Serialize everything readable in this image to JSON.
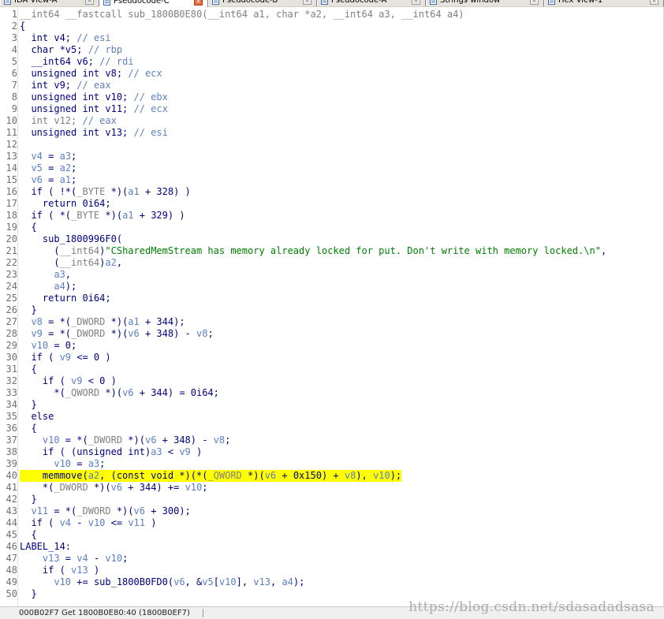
{
  "tabs": [
    {
      "label": "IDA View-A",
      "active": false
    },
    {
      "label": "Pseudocode-C",
      "active": true
    },
    {
      "label": "Pseudocode-B",
      "active": false
    },
    {
      "label": "Pseudocode-A",
      "active": false
    },
    {
      "label": "Strings window",
      "active": false
    },
    {
      "label": "Hex View-1",
      "active": false
    }
  ],
  "colors": {
    "keyword": "#000080",
    "variable": "#5b7fc4",
    "string": "#008000",
    "highlight": "#ffff00"
  },
  "code": {
    "lines": [
      {
        "n": "1",
        "tokens": [
          [
            "g",
            "__int64 __fastcall sub_1800B0E80(__int64 a1, char *a2, __int64 a3, __int64 a4)"
          ]
        ]
      },
      {
        "n": "2",
        "tokens": [
          [
            "k",
            "{"
          ]
        ]
      },
      {
        "n": "3",
        "tokens": [
          [
            "k",
            "  int v4; "
          ],
          [
            "c",
            "// esi"
          ]
        ]
      },
      {
        "n": "4",
        "tokens": [
          [
            "k",
            "  char *v5; "
          ],
          [
            "c",
            "// rbp"
          ]
        ]
      },
      {
        "n": "5",
        "tokens": [
          [
            "k",
            "  __int64 v6; "
          ],
          [
            "c",
            "// rdi"
          ]
        ]
      },
      {
        "n": "6",
        "tokens": [
          [
            "k",
            "  unsigned int v8; "
          ],
          [
            "c",
            "// ecx"
          ]
        ]
      },
      {
        "n": "7",
        "tokens": [
          [
            "k",
            "  int v9; "
          ],
          [
            "c",
            "// eax"
          ]
        ]
      },
      {
        "n": "8",
        "tokens": [
          [
            "k",
            "  unsigned int v10; "
          ],
          [
            "c",
            "// ebx"
          ]
        ]
      },
      {
        "n": "9",
        "tokens": [
          [
            "k",
            "  unsigned int v11; "
          ],
          [
            "c",
            "// ecx"
          ]
        ]
      },
      {
        "n": "10",
        "tokens": [
          [
            "g",
            "  int v12; "
          ],
          [
            "c",
            "// eax"
          ]
        ]
      },
      {
        "n": "11",
        "tokens": [
          [
            "k",
            "  unsigned int v13; "
          ],
          [
            "c",
            "// esi"
          ]
        ]
      },
      {
        "n": "12",
        "tokens": []
      },
      {
        "n": "13",
        "tokens": [
          [
            "v",
            "  v4"
          ],
          [
            "k",
            " = "
          ],
          [
            "v",
            "a3"
          ],
          [
            "k",
            ";"
          ]
        ]
      },
      {
        "n": "14",
        "tokens": [
          [
            "v",
            "  v5"
          ],
          [
            "k",
            " = "
          ],
          [
            "v",
            "a2"
          ],
          [
            "k",
            ";"
          ]
        ]
      },
      {
        "n": "15",
        "tokens": [
          [
            "v",
            "  v6"
          ],
          [
            "k",
            " = "
          ],
          [
            "v",
            "a1"
          ],
          [
            "k",
            ";"
          ]
        ]
      },
      {
        "n": "16",
        "tokens": [
          [
            "k",
            "  if ( !*("
          ],
          [
            "g",
            "_BYTE"
          ],
          [
            "k",
            " *)("
          ],
          [
            "v",
            "a1"
          ],
          [
            "k",
            " + 328) )"
          ]
        ]
      },
      {
        "n": "17",
        "tokens": [
          [
            "k",
            "    return 0i64;"
          ]
        ]
      },
      {
        "n": "18",
        "tokens": [
          [
            "k",
            "  if ( *("
          ],
          [
            "g",
            "_BYTE"
          ],
          [
            "k",
            " *)("
          ],
          [
            "v",
            "a1"
          ],
          [
            "k",
            " + 329) )"
          ]
        ]
      },
      {
        "n": "19",
        "tokens": [
          [
            "k",
            "  {"
          ]
        ]
      },
      {
        "n": "20",
        "tokens": [
          [
            "f",
            "    sub_1800996F0("
          ]
        ]
      },
      {
        "n": "21",
        "tokens": [
          [
            "k",
            "      ("
          ],
          [
            "g",
            "__int64"
          ],
          [
            "k",
            ")"
          ],
          [
            "s",
            "\"CSharedMemStream has memory already locked for put. Don't write with memory locked.\\n\""
          ],
          [
            "k",
            ","
          ]
        ]
      },
      {
        "n": "22",
        "tokens": [
          [
            "k",
            "      ("
          ],
          [
            "g",
            "__int64"
          ],
          [
            "k",
            ")"
          ],
          [
            "v",
            "a2"
          ],
          [
            "k",
            ","
          ]
        ]
      },
      {
        "n": "23",
        "tokens": [
          [
            "v",
            "      a3"
          ],
          [
            "k",
            ","
          ]
        ]
      },
      {
        "n": "24",
        "tokens": [
          [
            "v",
            "      a4"
          ],
          [
            "k",
            ");"
          ]
        ]
      },
      {
        "n": "25",
        "tokens": [
          [
            "k",
            "    return 0i64;"
          ]
        ]
      },
      {
        "n": "26",
        "tokens": [
          [
            "k",
            "  }"
          ]
        ]
      },
      {
        "n": "27",
        "tokens": [
          [
            "v",
            "  v8"
          ],
          [
            "k",
            " = *("
          ],
          [
            "g",
            "_DWORD"
          ],
          [
            "k",
            " *)("
          ],
          [
            "v",
            "a1"
          ],
          [
            "k",
            " + 344);"
          ]
        ]
      },
      {
        "n": "28",
        "tokens": [
          [
            "v",
            "  v9"
          ],
          [
            "k",
            " = *("
          ],
          [
            "g",
            "_DWORD"
          ],
          [
            "k",
            " *)("
          ],
          [
            "v",
            "v6"
          ],
          [
            "k",
            " + 348) - "
          ],
          [
            "v",
            "v8"
          ],
          [
            "k",
            ";"
          ]
        ]
      },
      {
        "n": "29",
        "tokens": [
          [
            "v",
            "  v10"
          ],
          [
            "k",
            " = 0;"
          ]
        ]
      },
      {
        "n": "30",
        "tokens": [
          [
            "k",
            "  if ( "
          ],
          [
            "v",
            "v9"
          ],
          [
            "k",
            " <= 0 )"
          ]
        ]
      },
      {
        "n": "31",
        "tokens": [
          [
            "k",
            "  {"
          ]
        ]
      },
      {
        "n": "32",
        "tokens": [
          [
            "k",
            "    if ( "
          ],
          [
            "v",
            "v9"
          ],
          [
            "k",
            " < 0 )"
          ]
        ]
      },
      {
        "n": "33",
        "tokens": [
          [
            "k",
            "      *("
          ],
          [
            "g",
            "_QWORD"
          ],
          [
            "k",
            " *)("
          ],
          [
            "v",
            "v6"
          ],
          [
            "k",
            " + 344) = 0i64;"
          ]
        ]
      },
      {
        "n": "34",
        "tokens": [
          [
            "k",
            "  }"
          ]
        ]
      },
      {
        "n": "35",
        "tokens": [
          [
            "k",
            "  else"
          ]
        ]
      },
      {
        "n": "36",
        "tokens": [
          [
            "k",
            "  {"
          ]
        ]
      },
      {
        "n": "37",
        "tokens": [
          [
            "v",
            "    v10"
          ],
          [
            "k",
            " = *("
          ],
          [
            "g",
            "_DWORD"
          ],
          [
            "k",
            " *)("
          ],
          [
            "v",
            "v6"
          ],
          [
            "k",
            " + 348) - "
          ],
          [
            "v",
            "v8"
          ],
          [
            "k",
            ";"
          ]
        ]
      },
      {
        "n": "38",
        "tokens": [
          [
            "k",
            "    if ( (unsigned int)"
          ],
          [
            "v",
            "a3"
          ],
          [
            "k",
            " < "
          ],
          [
            "v",
            "v9"
          ],
          [
            "k",
            " )"
          ]
        ]
      },
      {
        "n": "39",
        "tokens": [
          [
            "v",
            "      v10"
          ],
          [
            "k",
            " = "
          ],
          [
            "v",
            "a3"
          ],
          [
            "k",
            ";"
          ]
        ]
      },
      {
        "n": "40",
        "highlight": true,
        "tokens": [
          [
            "f",
            "    memmove("
          ],
          [
            "v",
            "a2"
          ],
          [
            "k",
            ", (const void *)(*("
          ],
          [
            "g",
            "_QWORD"
          ],
          [
            "k",
            " *)("
          ],
          [
            "v",
            "v6"
          ],
          [
            "k",
            " + 0x150) + "
          ],
          [
            "v",
            "v8"
          ],
          [
            "k",
            "), "
          ],
          [
            "v",
            "v10"
          ],
          [
            "k",
            ");"
          ]
        ]
      },
      {
        "n": "41",
        "tokens": [
          [
            "k",
            "    *("
          ],
          [
            "g",
            "_DWORD"
          ],
          [
            "k",
            " *)("
          ],
          [
            "v",
            "v6"
          ],
          [
            "k",
            " + 344) += "
          ],
          [
            "v",
            "v10"
          ],
          [
            "k",
            ";"
          ]
        ]
      },
      {
        "n": "42",
        "tokens": [
          [
            "k",
            "  }"
          ]
        ]
      },
      {
        "n": "43",
        "tokens": [
          [
            "v",
            "  v11"
          ],
          [
            "k",
            " = *("
          ],
          [
            "g",
            "_DWORD"
          ],
          [
            "k",
            " *)("
          ],
          [
            "v",
            "v6"
          ],
          [
            "k",
            " + 300);"
          ]
        ]
      },
      {
        "n": "44",
        "tokens": [
          [
            "k",
            "  if ( "
          ],
          [
            "v",
            "v4"
          ],
          [
            "k",
            " - "
          ],
          [
            "v",
            "v10"
          ],
          [
            "k",
            " <= "
          ],
          [
            "v",
            "v11"
          ],
          [
            "k",
            " )"
          ]
        ]
      },
      {
        "n": "45",
        "tokens": [
          [
            "k",
            "  {"
          ]
        ]
      },
      {
        "n": "46",
        "tokens": [
          [
            "k",
            "LABEL_14:"
          ]
        ]
      },
      {
        "n": "47",
        "tokens": [
          [
            "v",
            "    v13"
          ],
          [
            "k",
            " = "
          ],
          [
            "v",
            "v4"
          ],
          [
            "k",
            " - "
          ],
          [
            "v",
            "v10"
          ],
          [
            "k",
            ";"
          ]
        ]
      },
      {
        "n": "48",
        "tokens": [
          [
            "k",
            "    if ( "
          ],
          [
            "v",
            "v13"
          ],
          [
            "k",
            " )"
          ]
        ]
      },
      {
        "n": "49",
        "tokens": [
          [
            "v",
            "      v10"
          ],
          [
            "k",
            " += "
          ],
          [
            "f",
            "sub_1800B0FD0("
          ],
          [
            "v",
            "v6"
          ],
          [
            "k",
            ", &"
          ],
          [
            "v",
            "v5"
          ],
          [
            "k",
            "["
          ],
          [
            "v",
            "v10"
          ],
          [
            "k",
            "], "
          ],
          [
            "v",
            "v13"
          ],
          [
            "k",
            ", "
          ],
          [
            "v",
            "a4"
          ],
          [
            "k",
            ");"
          ]
        ]
      },
      {
        "n": "50",
        "tokens": [
          [
            "k",
            "  }"
          ]
        ]
      }
    ]
  },
  "statusbar": {
    "text": "000B02F7 Get 1800B0E80:40 (1800B0EF7)"
  },
  "watermark": "https://blog.csdn.net/sdasadadsasa"
}
